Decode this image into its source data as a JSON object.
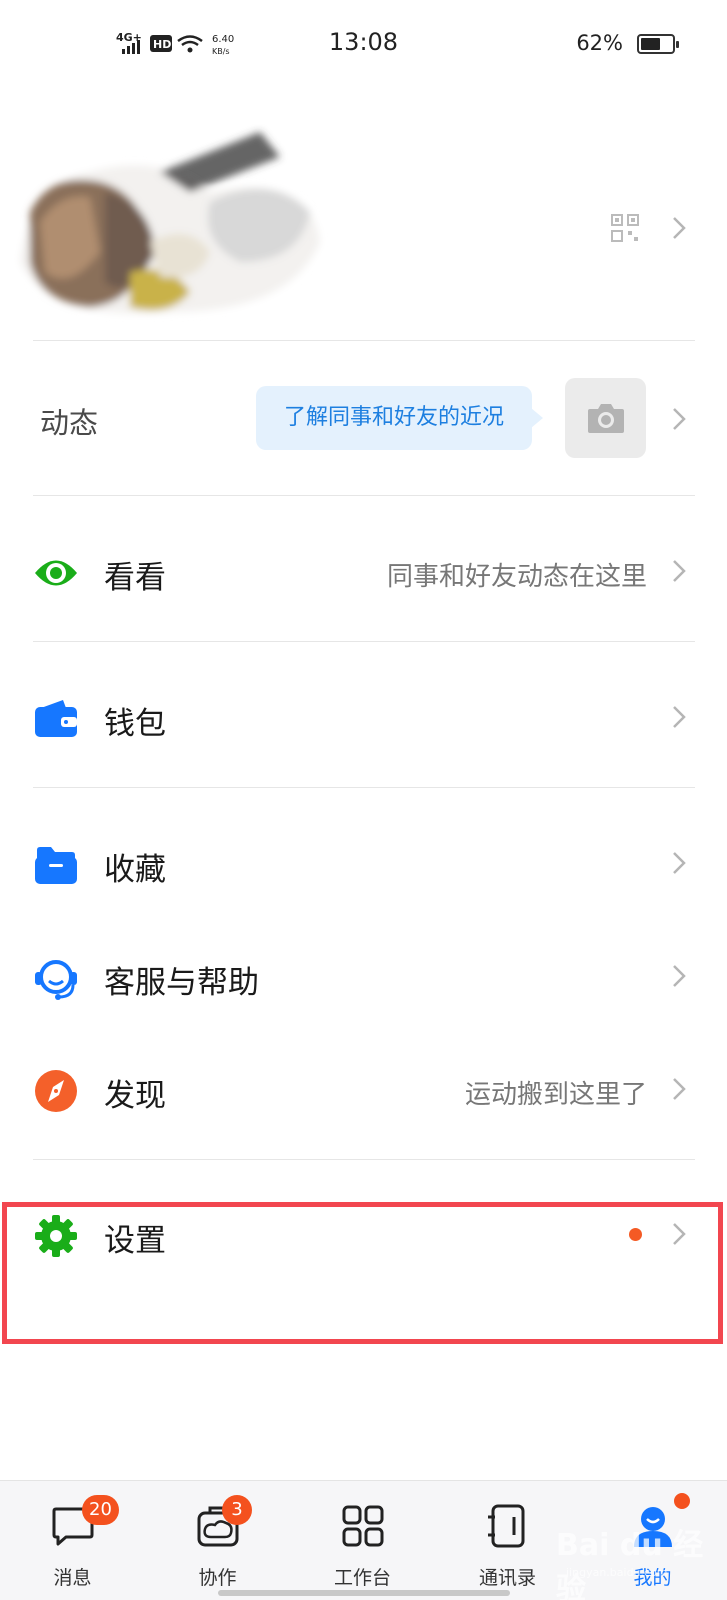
{
  "status_bar": {
    "network": "4G+",
    "hd": "HD",
    "speed_value": "6.40",
    "speed_unit": "KB/s",
    "time": "13:08",
    "battery_text": "62%",
    "battery_level": 0.62
  },
  "dynamics": {
    "label": "动态",
    "bubble_text": "了解同事和好友的近况"
  },
  "menu": {
    "kankan": {
      "label": "看看",
      "sub": "同事和好友动态在这里",
      "icon": "eye-icon",
      "color": "#1aad19"
    },
    "wallet": {
      "label": "钱包",
      "icon": "wallet-icon",
      "color": "#1677ff"
    },
    "favorites": {
      "label": "收藏",
      "icon": "folder-icon",
      "color": "#1677ff"
    },
    "support": {
      "label": "客服与帮助",
      "icon": "headset-icon",
      "color": "#1677ff"
    },
    "discover": {
      "label": "发现",
      "sub": "运动搬到这里了",
      "icon": "compass-icon",
      "color": "#f4602a"
    },
    "settings": {
      "label": "设置",
      "icon": "gear-icon",
      "color": "#1aad19",
      "has_dot": true
    }
  },
  "tabbar": {
    "tabs": [
      {
        "label": "消息",
        "icon": "chat-icon",
        "badge": "20"
      },
      {
        "label": "协作",
        "icon": "collaboration-icon",
        "badge": "3"
      },
      {
        "label": "工作台",
        "icon": "grid-icon"
      },
      {
        "label": "通讯录",
        "icon": "contacts-icon"
      },
      {
        "label": "我的",
        "icon": "profile-icon",
        "active": true,
        "dot": true
      }
    ]
  },
  "watermark": {
    "text": "Bai du 经验",
    "sub": "jingyan.baidu.com"
  },
  "colors": {
    "accent": "#1677ff",
    "badge": "#f4511e",
    "highlight": "#f2464f"
  }
}
